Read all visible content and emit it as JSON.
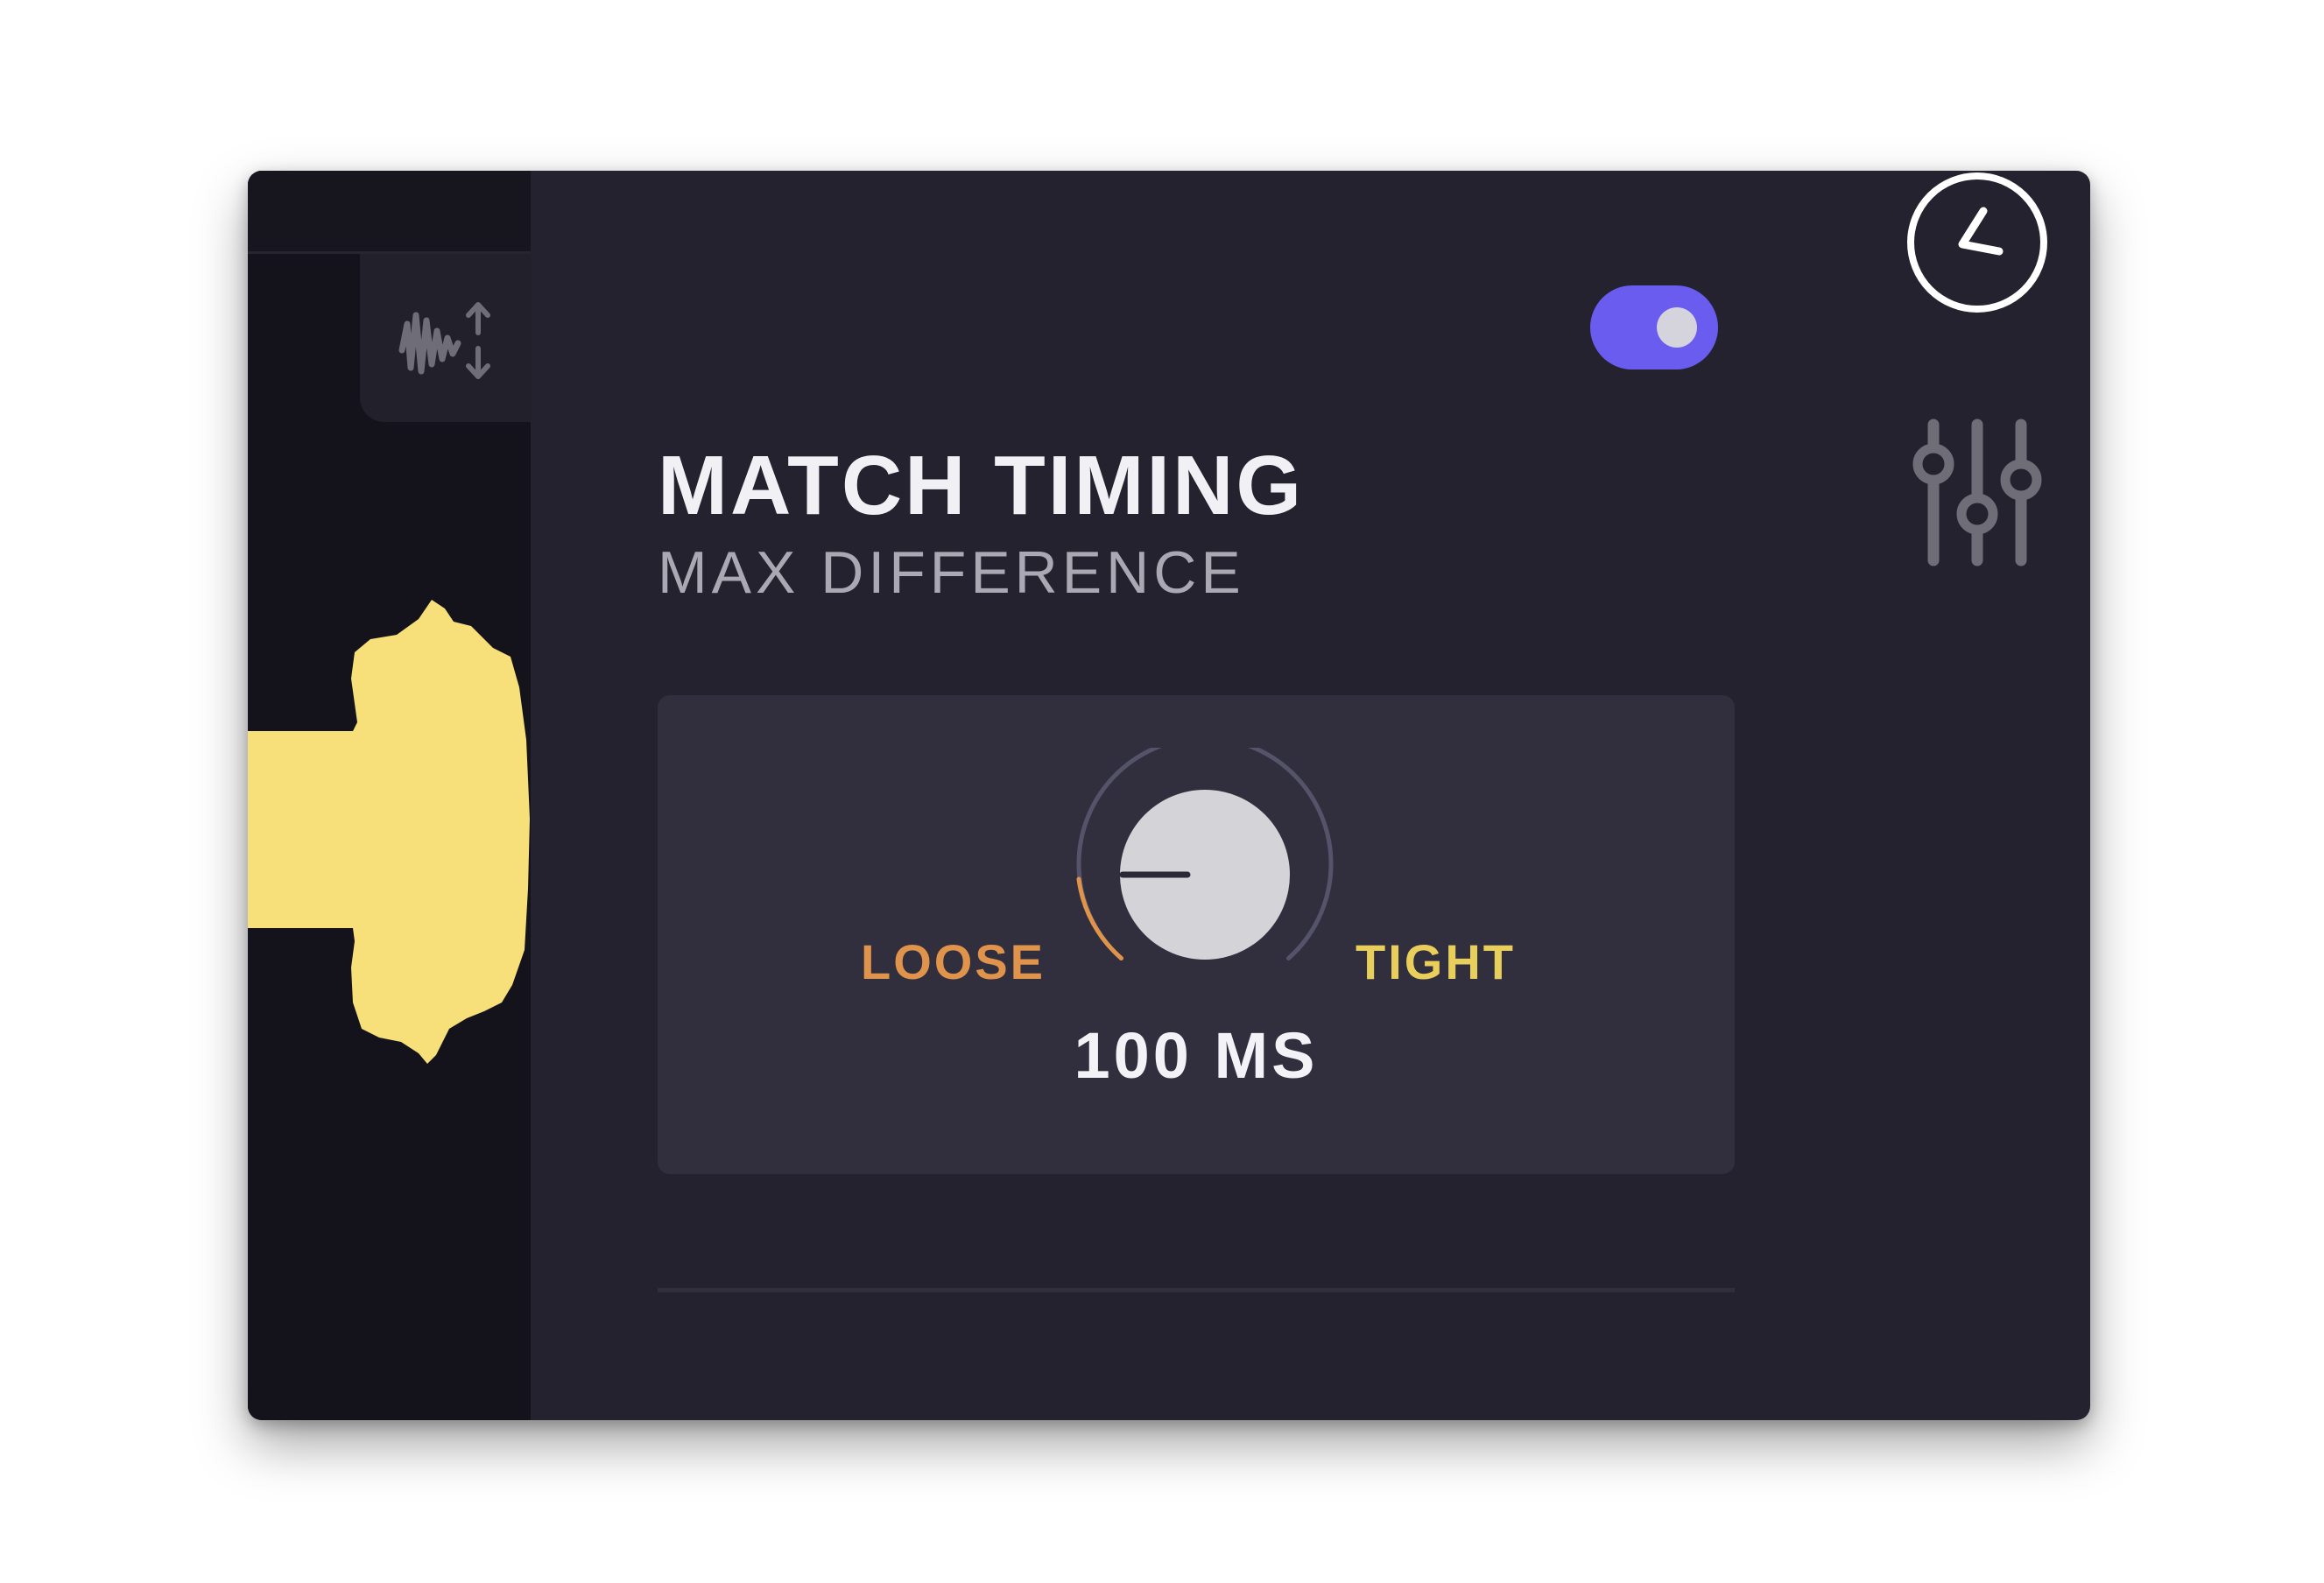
{
  "panel": {
    "title": "MATCH TIMING",
    "toggle_on": true,
    "section_label": "MAX DIFFERENCE",
    "knob": {
      "min_label": "LOOSE",
      "max_label": "TIGHT",
      "value_text": "100 MS",
      "level": 0.05
    }
  },
  "icons": {
    "history": "clock-icon",
    "mixer": "sliders-icon",
    "waveform_tab": "waveform-adjust-icon"
  },
  "colors": {
    "background": "#23222e",
    "accent_toggle": "#6b5cf0",
    "waveform": "#f7e07a",
    "loose": "#e0934a",
    "tight": "#e8cf5c"
  }
}
